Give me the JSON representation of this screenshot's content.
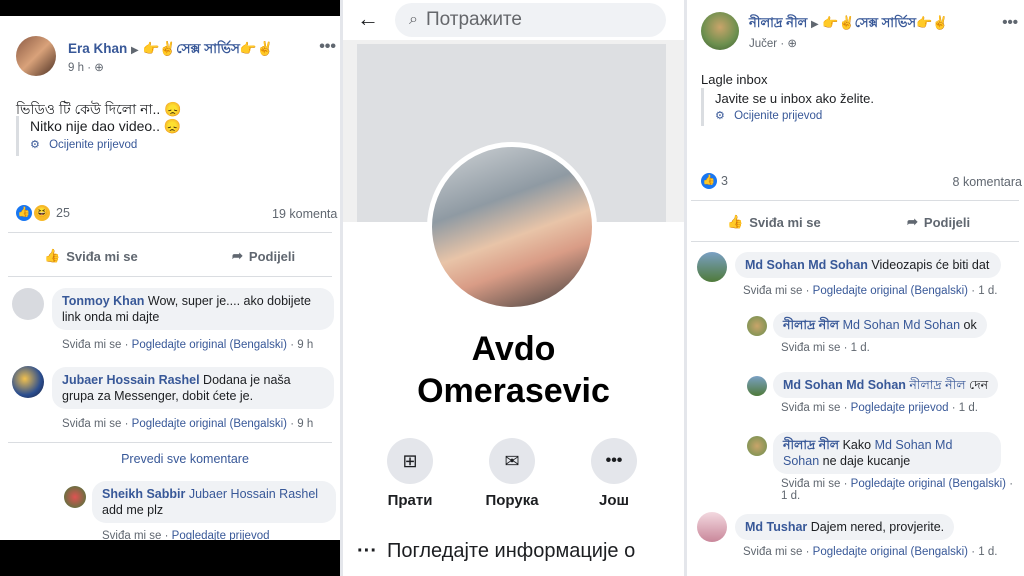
{
  "left": {
    "post_author": "Era Khan",
    "post_to": "👉✌️সেক্স সার্ভিস👉✌️",
    "post_time": "9 h",
    "original_text": "ভিডিও টি কেউ দিলো না.. 😞",
    "translated_text": "Nitko nije dao video.. 😞",
    "rate_translation": "Ocijenite prijevod",
    "reaction_count": "25",
    "comment_count": "19 komenta",
    "like_label": "Sviđa mi se",
    "share_label": "Podijeli",
    "comments": [
      {
        "name": "Tonmoy Khan",
        "text": "Wow, super je.... ako dobijete link onda mi dajte",
        "like": "Sviđa mi se",
        "original": "Pogledajte original (Bengalski)",
        "time": "9 h"
      },
      {
        "name": "Jubaer Hossain Rashel",
        "text": "Dodana je naša grupa za Messenger, dobit ćete je.",
        "like": "Sviđa mi se",
        "original": "Pogledajte original (Bengalski)",
        "time": "9 h"
      }
    ],
    "translate_all": "Prevedi sve komentare",
    "reply": {
      "name": "Sheikh Sabbir",
      "mention": "Jubaer Hossain Rashel",
      "text": "add me plz",
      "like": "Sviđa mi se",
      "original": "Pogledajte prijevod"
    }
  },
  "middle": {
    "search_placeholder": "Потражите",
    "profile_name_line1": "Avdo",
    "profile_name_line2": "Omerasevic",
    "buttons": [
      {
        "label": "Прати"
      },
      {
        "label": "Порука"
      },
      {
        "label": "Још"
      }
    ],
    "info_label": "Погледајте информације о"
  },
  "right": {
    "post_author": "নীলাদ্র নীল",
    "post_to": "👉✌️সেক্স সার্ভিস👉✌️",
    "post_time": "Jučer",
    "original_text": "Lagle inbox",
    "translated_text": "Javite se u inbox ako želite.",
    "rate_translation": "Ocijenite prijevod",
    "reaction_count": "3",
    "comment_count": "8 komentara",
    "like_label": "Sviđa mi se",
    "share_label": "Podijeli",
    "c1": {
      "name": "Md Sohan Md Sohan",
      "text": "Videozapis će biti dat",
      "like": "Sviđa mi se",
      "original": "Pogledajte original (Bengalski)",
      "time": "1 d."
    },
    "r1": {
      "name": "নীলাদ্র নীল",
      "mention": "Md Sohan Md Sohan",
      "text": "ok",
      "like": "Sviđa mi se",
      "time": "1 d."
    },
    "r2": {
      "name": "Md Sohan Md Sohan",
      "mention": "নীলাদ্র নীল",
      "text": "দেন",
      "like": "Sviđa mi se",
      "original": "Pogledajte prijevod",
      "time": "1 d."
    },
    "r3": {
      "name": "নীলাদ্র নীল",
      "text1": "Kako",
      "mention": "Md Sohan Md Sohan",
      "text2": "ne daje kucanje",
      "like": "Sviđa mi se",
      "original": "Pogledajte original (Bengalski)",
      "time": "1 d."
    },
    "c2": {
      "name": "Md Tushar",
      "text": "Dajem nered, provjerite.",
      "like": "Sviđa mi se",
      "original": "Pogledajte original (Bengalski)",
      "time": "1 d."
    }
  }
}
